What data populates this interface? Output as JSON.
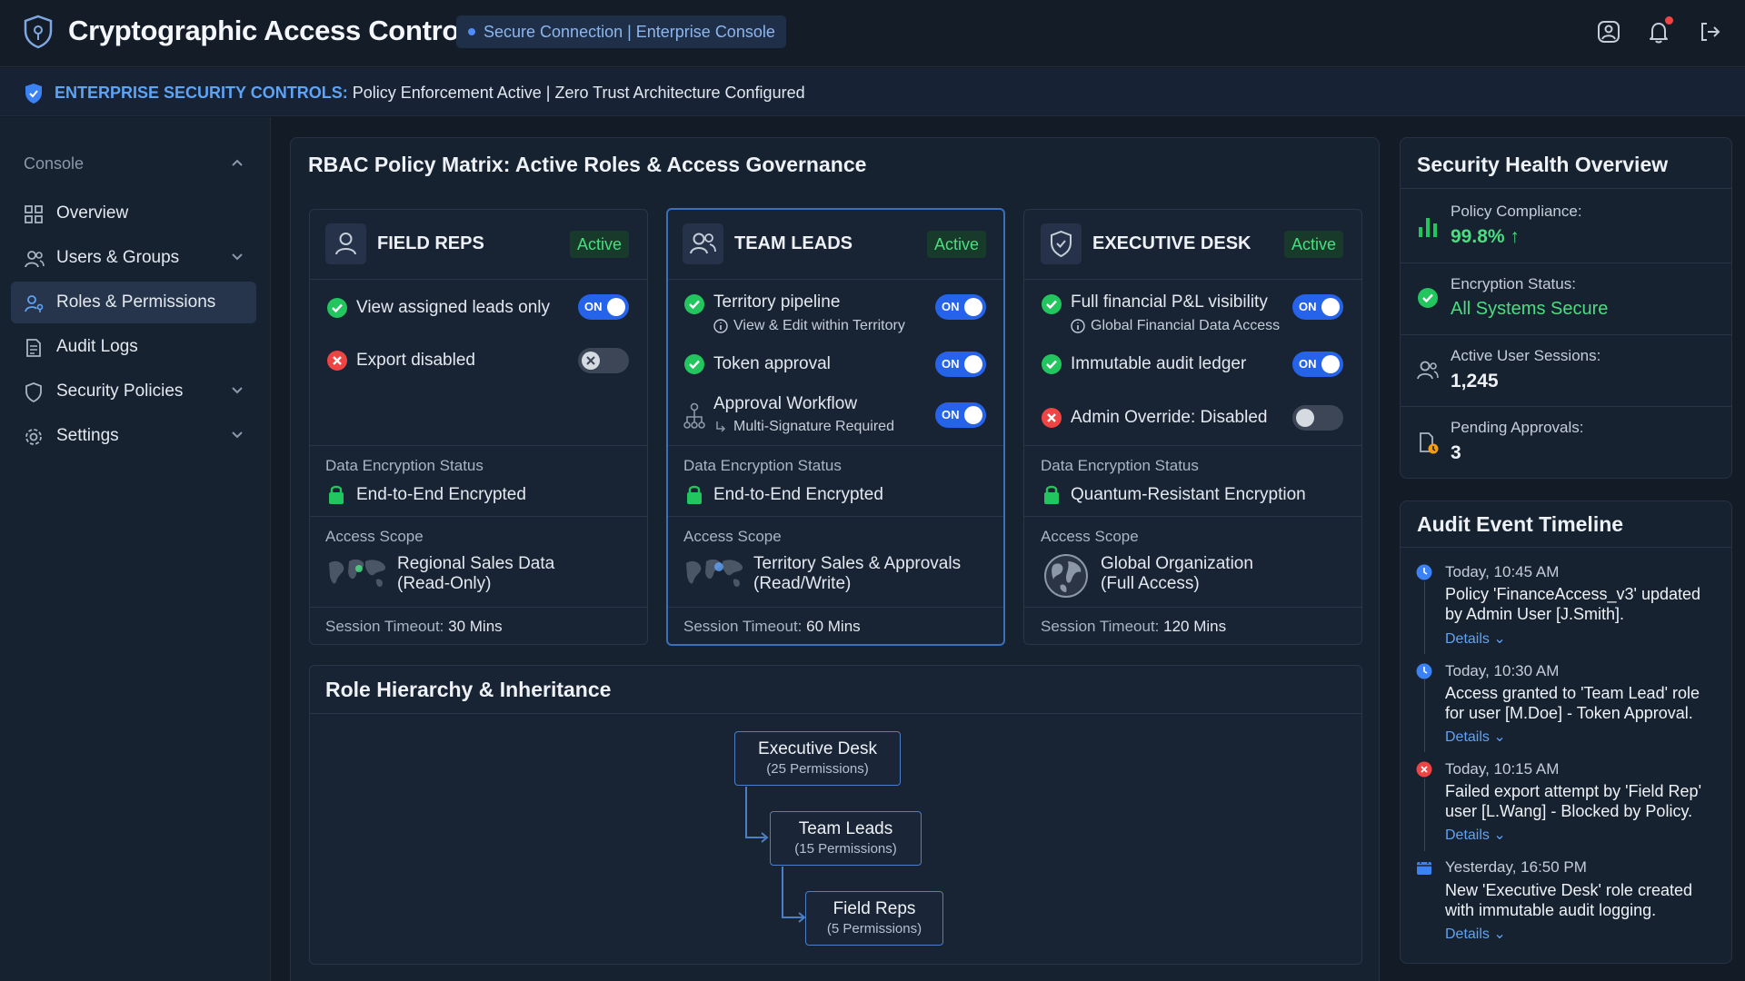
{
  "header": {
    "title": "Cryptographic Access Control",
    "connection": "Secure Connection | Enterprise Console"
  },
  "banner": {
    "label": "ENTERPRISE SECURITY CONTROLS:",
    "text": " Policy Enforcement Active | Zero Trust Architecture Configured"
  },
  "sidebar": {
    "section": "Console",
    "items": [
      {
        "label": "Overview",
        "icon": "grid-icon"
      },
      {
        "label": "Users & Groups",
        "icon": "users-icon"
      },
      {
        "label": "Roles & Permissions",
        "icon": "user-key-icon",
        "active": true
      },
      {
        "label": "Audit Logs",
        "icon": "document-icon"
      },
      {
        "label": "Security Policies",
        "icon": "shield-icon"
      },
      {
        "label": "Settings",
        "icon": "gear-icon"
      }
    ]
  },
  "matrix": {
    "title": "RBAC Policy Matrix: Active Roles & Access Governance",
    "roles": [
      {
        "name": "FIELD REPS",
        "status": "Active",
        "perms": [
          {
            "label": "View assigned leads only",
            "state": "on"
          },
          {
            "label": "Export disabled",
            "state": "off"
          }
        ],
        "enc_label": "Data Encryption Status",
        "enc_value": "End-to-End Encrypted",
        "scope_label": "Access Scope",
        "scope_l1": "Regional Sales Data",
        "scope_l2": "(Read-Only)",
        "timeout_label": "Session Timeout:",
        "timeout_value": "30 Mins"
      },
      {
        "name": "TEAM LEADS",
        "status": "Active",
        "perms": [
          {
            "label": "Territory pipeline",
            "sub": "View & Edit within Territory",
            "state": "on"
          },
          {
            "label": "Token approval",
            "state": "on"
          },
          {
            "label": "Approval Workflow",
            "sub": "Multi-Signature Required",
            "state": "on"
          }
        ],
        "enc_label": "Data Encryption Status",
        "enc_value": "End-to-End Encrypted",
        "scope_label": "Access Scope",
        "scope_l1": "Territory Sales & Approvals",
        "scope_l2": "(Read/Write)",
        "timeout_label": "Session Timeout:",
        "timeout_value": "60 Mins"
      },
      {
        "name": "EXECUTIVE DESK",
        "status": "Active",
        "perms": [
          {
            "label": "Full financial P&L visibility",
            "sub": "Global Financial Data Access",
            "state": "on"
          },
          {
            "label": "Immutable audit ledger",
            "state": "on"
          },
          {
            "label": "Admin Override: Disabled",
            "state": "off"
          }
        ],
        "enc_label": "Data Encryption Status",
        "enc_value": "Quantum-Resistant Encryption",
        "scope_label": "Access Scope",
        "scope_l1": "Global Organization",
        "scope_l2": "(Full Access)",
        "timeout_label": "Session Timeout:",
        "timeout_value": "120 Mins"
      }
    ],
    "toggle_on_label": "ON"
  },
  "hierarchy": {
    "title": "Role Hierarchy & Inheritance",
    "nodes": [
      {
        "name": "Executive Desk",
        "perms": "(25 Permissions)"
      },
      {
        "name": "Team Leads",
        "perms": "(15 Permissions)"
      },
      {
        "name": "Field Reps",
        "perms": "(5 Permissions)"
      }
    ]
  },
  "health": {
    "title": "Security Health Overview",
    "stats": [
      {
        "label": "Policy Compliance:",
        "value": "99.8%",
        "trend": "↑"
      },
      {
        "label": "Encryption Status:",
        "value": "All Systems Secure"
      },
      {
        "label": "Active User Sessions:",
        "value": "1,245"
      },
      {
        "label": "Pending Approvals:",
        "value": "3"
      }
    ]
  },
  "audit": {
    "title": "Audit Event Timeline",
    "details_label": "Details",
    "events": [
      {
        "time": "Today, 10:45 AM",
        "l1": "Policy 'FinanceAccess_v3' updated",
        "l2": "by Admin User [J.Smith].",
        "type": "info"
      },
      {
        "time": "Today, 10:30 AM",
        "l1": "Access granted to 'Team Lead' role",
        "l2": "for user [M.Doe] - Token Approval.",
        "type": "info"
      },
      {
        "time": "Today, 10:15 AM",
        "l1": "Failed export attempt by 'Field Rep'",
        "l2": "user [L.Wang] - Blocked by Policy.",
        "type": "error"
      },
      {
        "time": "Yesterday, 16:50 PM",
        "l1": "New 'Executive Desk' role created",
        "l2": "with immutable audit logging.",
        "type": "calendar"
      }
    ]
  },
  "colors": {
    "accent": "#2563eb",
    "success": "#4ade80",
    "danger": "#ef4444",
    "link": "#5fa3f5"
  }
}
